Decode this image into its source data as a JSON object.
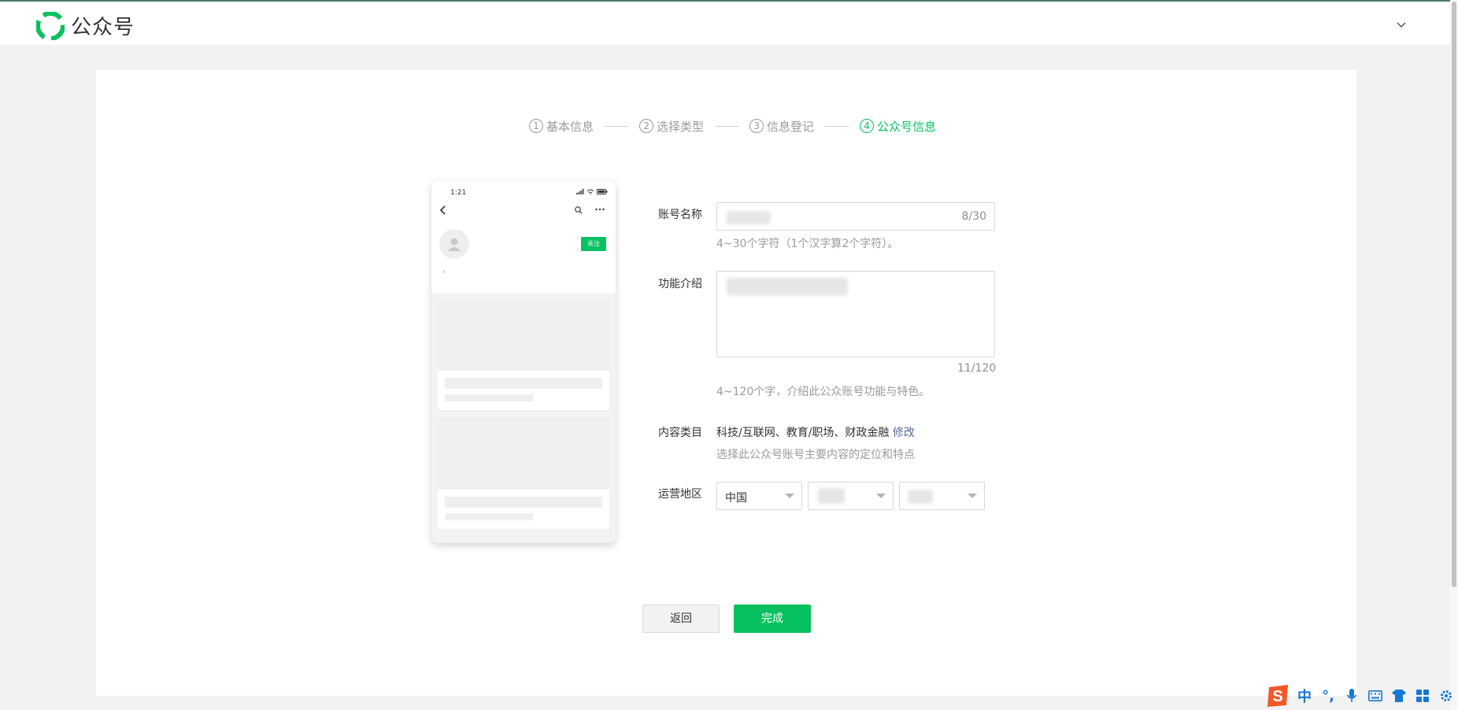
{
  "header": {
    "brand_name": "公众号",
    "brand_color": "#07c160",
    "account_menu_icon": "chevron-down-icon"
  },
  "steps": [
    {
      "num": "1",
      "label": "基本信息",
      "active": false
    },
    {
      "num": "2",
      "label": "选择类型",
      "active": false
    },
    {
      "num": "3",
      "label": "信息登记",
      "active": false
    },
    {
      "num": "4",
      "label": "公众号信息",
      "active": true
    }
  ],
  "preview": {
    "time": "1:21",
    "follow_label": "关注"
  },
  "form": {
    "name_label": "账号名称",
    "name_counter": "8/30",
    "name_hint": "4~30个字符（1个汉字算2个字符）。",
    "intro_label": "功能介绍",
    "intro_counter": "11/120",
    "intro_hint": "4~120个字，介绍此公众账号功能与特色。",
    "category_label": "内容类目",
    "category_value": "科技/互联网、教育/职场、财政金融",
    "category_edit": "修改",
    "category_hint": "选择此公众号账号主要内容的定位和特点",
    "region_label": "运营地区",
    "region_country": "中国"
  },
  "actions": {
    "back_label": "返回",
    "done_label": "完成"
  },
  "ime": {
    "lang_label": "中",
    "punct_label": "°,"
  }
}
